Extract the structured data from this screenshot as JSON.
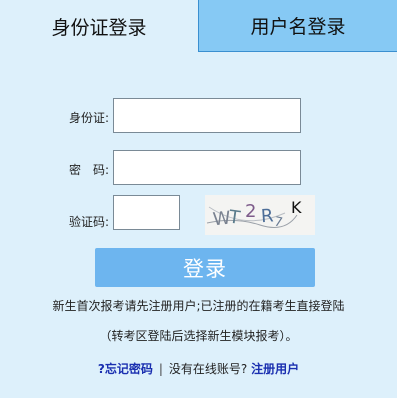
{
  "tabs": [
    {
      "label": "身份证登录",
      "active": true
    },
    {
      "label": "用户名登录",
      "active": false
    }
  ],
  "form": {
    "id_label": "身份证:",
    "id_value": "",
    "password_label": "密　码:",
    "password_value": "",
    "captcha_label": "验证码:",
    "captcha_value": "",
    "captcha_text": [
      "W",
      "T",
      "2",
      "R",
      "7",
      "K"
    ]
  },
  "login_button": "登录",
  "notes": {
    "line1": "新生首次报考请先注册用户;已注册的在籍考生直接登陆",
    "line2": "（转考区登陆后选择新生模块报考）。"
  },
  "footer": {
    "forgot_password": "?忘记密码",
    "separator": "|",
    "no_account": "没有在线账号?",
    "register": "注册用户"
  },
  "colors": {
    "background": "#ddf0fb",
    "inactive_tab": "#86c9f4",
    "button": "#6db5ef",
    "link": "#1a2fb0"
  }
}
